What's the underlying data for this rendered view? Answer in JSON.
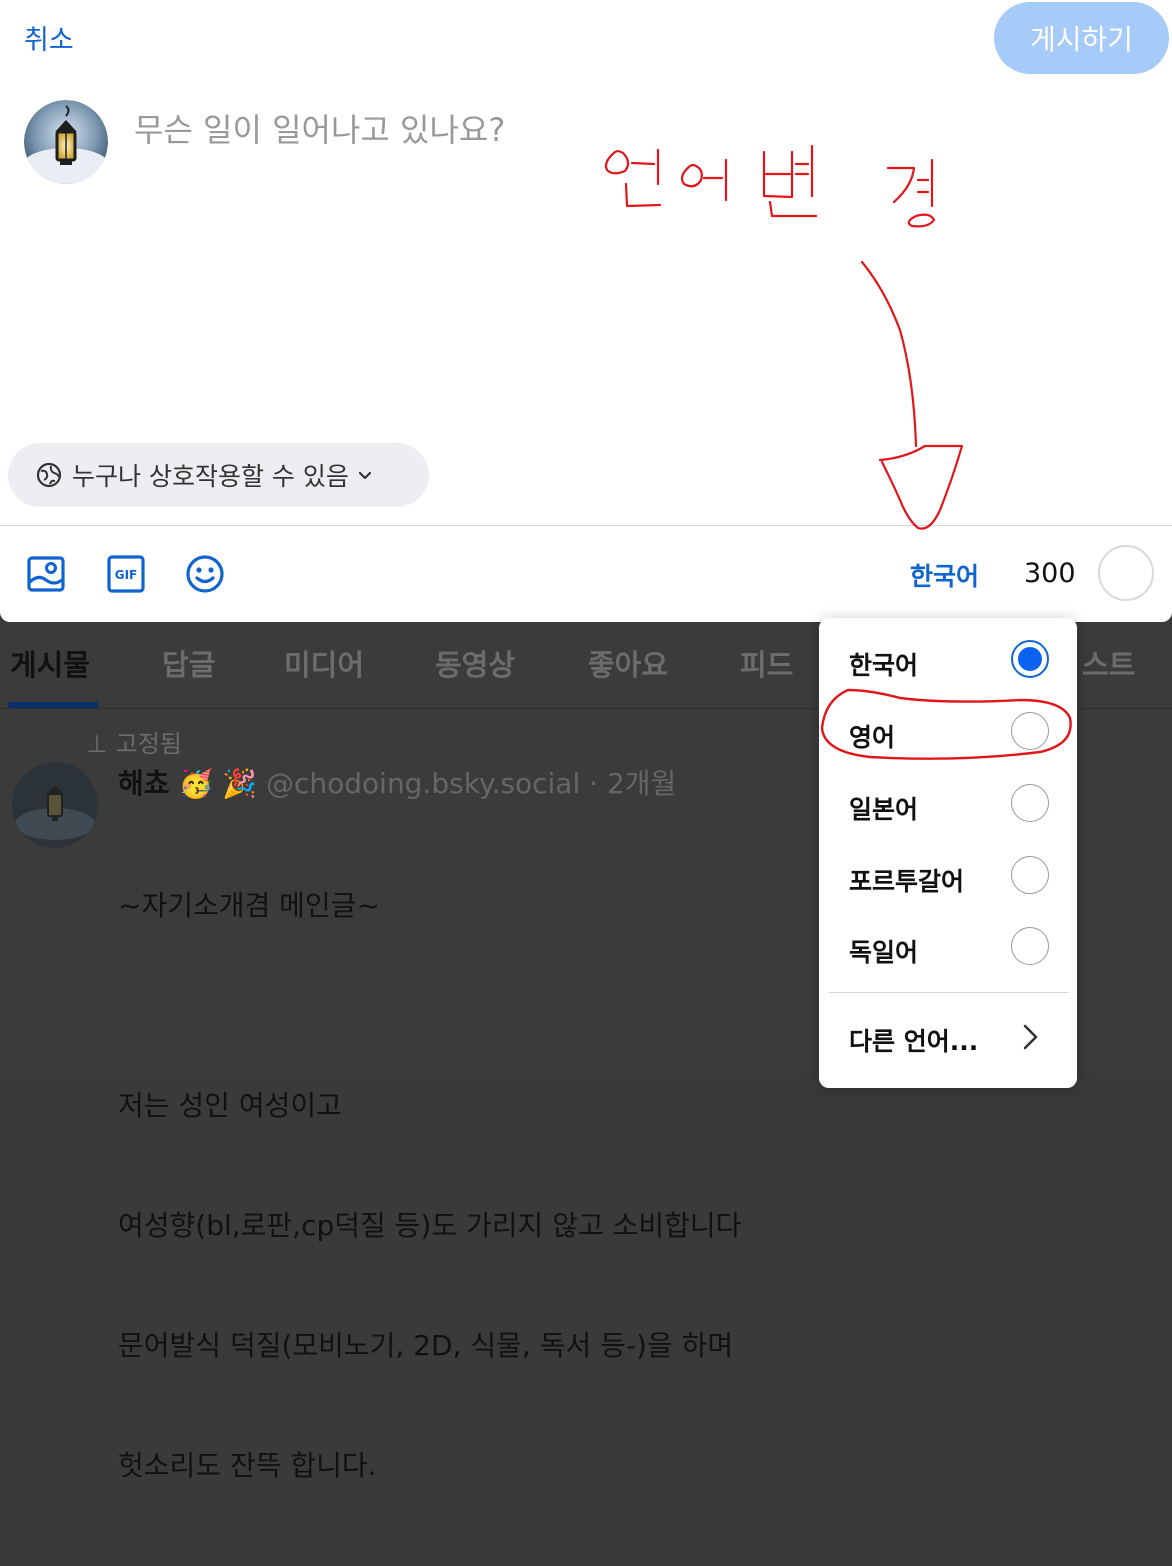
{
  "composer": {
    "cancel_label": "취소",
    "post_label": "게시하기",
    "placeholder": "무슨 일이 일어나고 있나요?",
    "interaction_label": "누구나 상호작용할 수 있음",
    "language_label": "한국어",
    "char_count": "300"
  },
  "annotation": {
    "note": "언어변경"
  },
  "language_menu": {
    "items": [
      {
        "label": "한국어",
        "selected": true
      },
      {
        "label": "영어",
        "selected": false
      },
      {
        "label": "일본어",
        "selected": false
      },
      {
        "label": "포르투갈어",
        "selected": false
      },
      {
        "label": "독일어",
        "selected": false
      }
    ],
    "more_label": "다른 언어..."
  },
  "profile": {
    "tabs": [
      "게시물",
      "답글",
      "미디어",
      "동영상",
      "좋아요",
      "피드",
      "스트"
    ],
    "pinned_label": "고정됨",
    "post": {
      "name": "해쵸",
      "handle": "@chodoing.bsky.social",
      "time": "· 2개월",
      "lines": [
        "~자기소개겸 메인글~",
        "",
        "저는 성인 여성이고",
        "여성향(bl,로판,cp덕질 등)도 가리지 않고 소비합니다",
        "문어발식 덕질(모비노기, 2D, 식물, 독서 등-)을 하며",
        "헛소리도 잔뜩 합니다."
      ]
    }
  },
  "colors": {
    "accent": "#1064d0",
    "post_button_disabled": "#a6cbf9",
    "radio_selected": "#0a63f0",
    "annotation_red": "#e0161b"
  },
  "icons": [
    "image-icon",
    "gif-icon",
    "emoji-icon",
    "globe-icon",
    "chevron-down-icon",
    "chevron-right-icon",
    "pin-icon"
  ]
}
